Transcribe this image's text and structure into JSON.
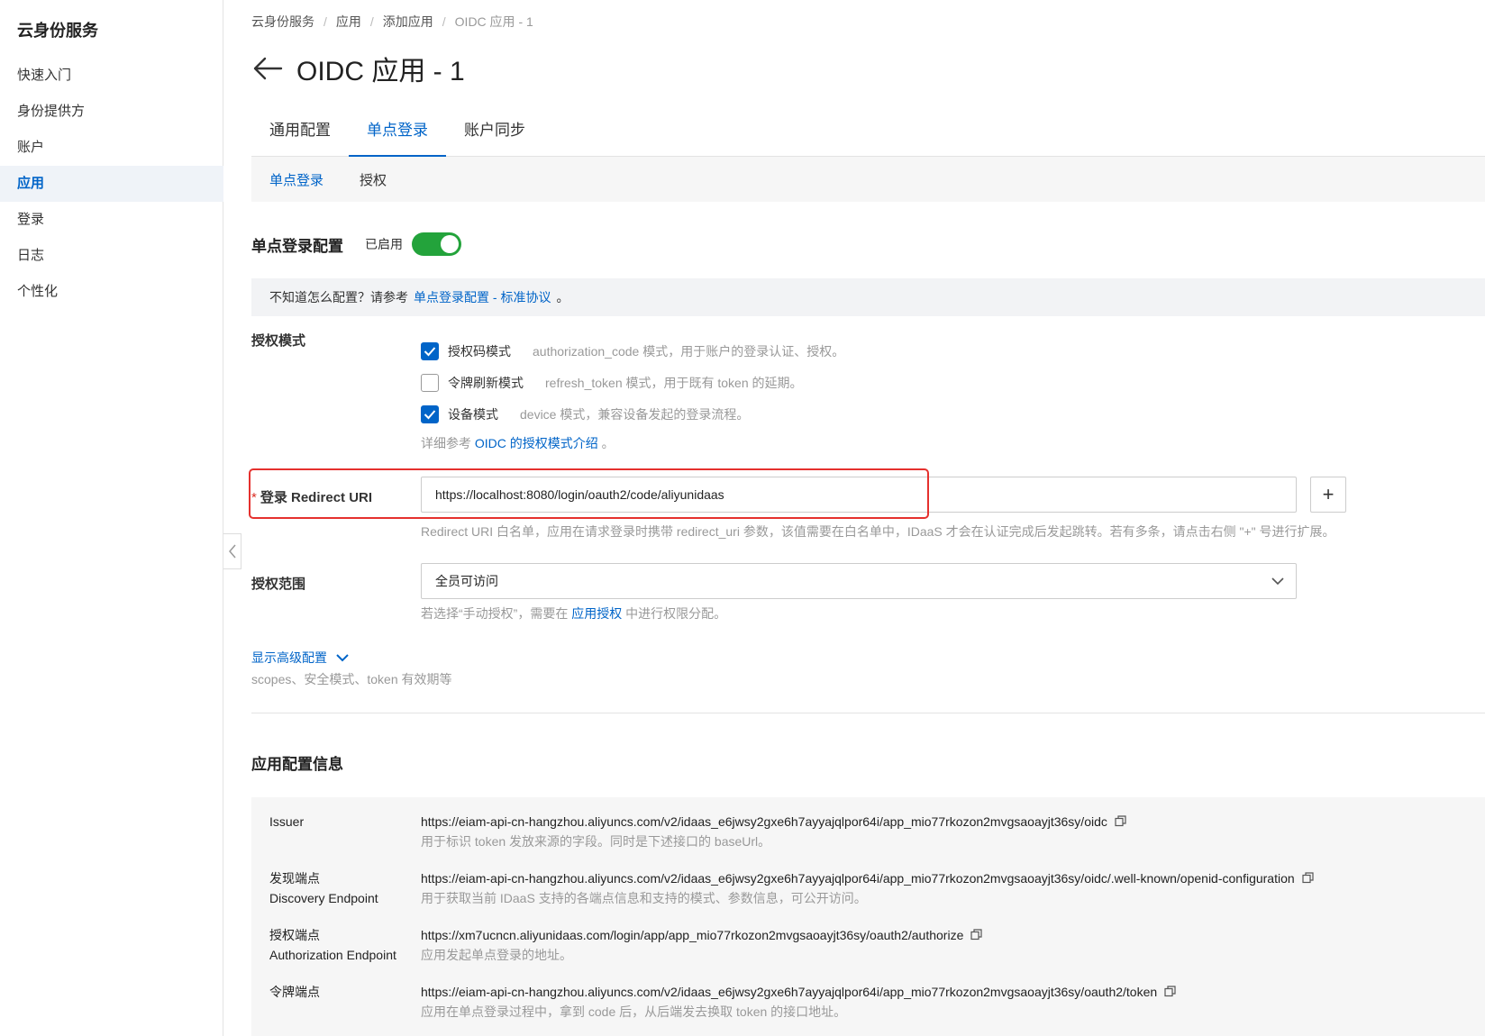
{
  "sidebar": {
    "title": "云身份服务",
    "items": [
      {
        "label": "快速入门"
      },
      {
        "label": "身份提供方"
      },
      {
        "label": "账户"
      },
      {
        "label": "应用"
      },
      {
        "label": "登录"
      },
      {
        "label": "日志"
      },
      {
        "label": "个性化"
      }
    ],
    "active_index": 3
  },
  "breadcrumb": [
    "云身份服务",
    "应用",
    "添加应用",
    "OIDC 应用 - 1"
  ],
  "page_title": "OIDC 应用 - 1",
  "tabs": [
    {
      "label": "通用配置"
    },
    {
      "label": "单点登录"
    },
    {
      "label": "账户同步"
    }
  ],
  "subtabs": [
    {
      "label": "单点登录"
    },
    {
      "label": "授权"
    }
  ],
  "sso_section": {
    "title": "单点登录配置",
    "toggle_label": "已启用",
    "enabled": true
  },
  "notice": {
    "text": "不知道怎么配置？请参考",
    "link": "单点登录配置 - 标准协议",
    "tail": "。"
  },
  "grant_types": {
    "label": "授权模式",
    "options": [
      {
        "label": "授权码模式",
        "desc": "authorization_code 模式，用于账户的登录认证、授权。",
        "checked": true
      },
      {
        "label": "令牌刷新模式",
        "desc": "refresh_token 模式，用于既有 token 的延期。",
        "checked": false
      },
      {
        "label": "设备模式",
        "desc": "device 模式，兼容设备发起的登录流程。",
        "checked": true
      }
    ],
    "hint_prefix": "详细参考",
    "hint_link": "OIDC 的授权模式介绍",
    "hint_suffix": "。"
  },
  "redirect_uri": {
    "required_mark": "*",
    "label": "登录 Redirect URI",
    "value": "https://localhost:8080/login/oauth2/code/aliyunidaas",
    "add_label": "+",
    "hint": "Redirect URI 白名单，应用在请求登录时携带 redirect_uri 参数，该值需要在白名单中，IDaaS 才会在认证完成后发起跳转。若有多条，请点击右侧 \"+\" 号进行扩展。"
  },
  "scope": {
    "label": "授权范围",
    "selected": "全员可访问",
    "hint_prefix": "若选择“手动授权”，需要在",
    "hint_link": "应用授权",
    "hint_suffix": "中进行权限分配。"
  },
  "advanced": {
    "label": "显示高级配置",
    "desc": "scopes、安全模式、token 有效期等"
  },
  "app_info": {
    "title": "应用配置信息",
    "rows": [
      {
        "key": "Issuer",
        "key2": "",
        "value": "https://eiam-api-cn-hangzhou.aliyuncs.com/v2/idaas_e6jwsy2gxe6h7ayyajqlpor64i/app_mio77rkozon2mvgsaoayjt36sy/oidc",
        "desc": "用于标识 token 发放来源的字段。同时是下述接口的 baseUrl。"
      },
      {
        "key": "发现端点",
        "key2": "Discovery Endpoint",
        "value": "https://eiam-api-cn-hangzhou.aliyuncs.com/v2/idaas_e6jwsy2gxe6h7ayyajqlpor64i/app_mio77rkozon2mvgsaoayjt36sy/oidc/.well-known/openid-configuration",
        "desc": "用于获取当前 IDaaS 支持的各端点信息和支持的模式、参数信息，可公开访问。"
      },
      {
        "key": "授权端点",
        "key2": "Authorization Endpoint",
        "value": "https://xm7ucncn.aliyunidaas.com/login/app/app_mio77rkozon2mvgsaoayjt36sy/oauth2/authorize",
        "desc": "应用发起单点登录的地址。"
      },
      {
        "key": "令牌端点",
        "key2": "",
        "value": "https://eiam-api-cn-hangzhou.aliyuncs.com/v2/idaas_e6jwsy2gxe6h7ayyajqlpor64i/app_mio77rkozon2mvgsaoayjt36sy/oauth2/token",
        "desc": "应用在单点登录过程中，拿到 code 后，从后端发去换取 token 的接口地址。"
      }
    ]
  },
  "colors": {
    "accent": "#0064c8",
    "toggle_on": "#23a33b",
    "highlight": "#e5312e"
  }
}
